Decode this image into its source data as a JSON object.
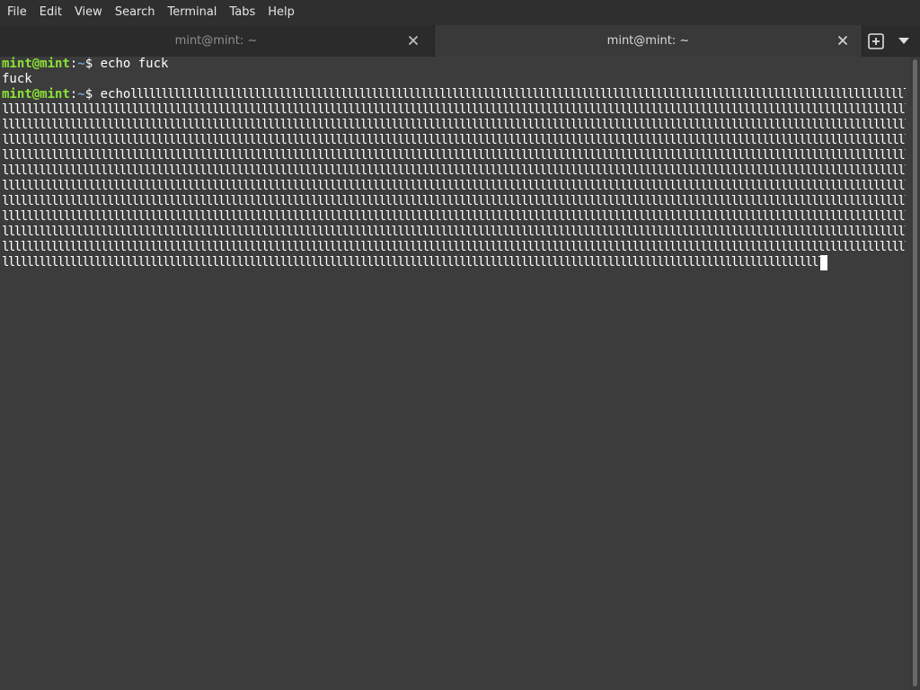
{
  "menubar": {
    "items": [
      "File",
      "Edit",
      "View",
      "Search",
      "Terminal",
      "Tabs",
      "Help"
    ]
  },
  "tabs": [
    {
      "label": "mint@mint: ~",
      "active": false
    },
    {
      "label": "mint@mint: ~",
      "active": true
    }
  ],
  "icons": {
    "tab_close": "close-icon",
    "new_tab": "new-tab-icon",
    "tab_menu": "chevron-down-icon"
  },
  "colors": {
    "prompt_user": "#8ae234",
    "prompt_path": "#729fcf",
    "text": "#ffffff",
    "background": "#3c3c3c"
  },
  "terminal": {
    "prompt_user": "mint@mint",
    "prompt_sep": ":",
    "prompt_path": "~",
    "prompt_end": "$ ",
    "cmd1": "echo fuck",
    "output1": "fuck",
    "cmd2_prefix": "echo ",
    "repeated_char": "l"
  }
}
